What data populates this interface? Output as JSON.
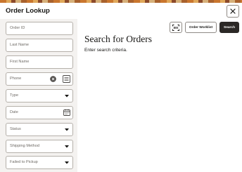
{
  "dialog": {
    "title": "Order Lookup",
    "close_icon": "close-icon"
  },
  "filters": {
    "order_id": {
      "placeholder": "Order ID"
    },
    "last_name": {
      "placeholder": "Last Name"
    },
    "first_name": {
      "placeholder": "First Name"
    },
    "phone": {
      "placeholder": "Phone",
      "clear_icon": "clear-circle-icon",
      "keypad_icon": "keypad-icon"
    },
    "type": {
      "placeholder": "Type",
      "icon": "chevron-down-icon"
    },
    "date": {
      "placeholder": "Date",
      "icon": "calendar-icon"
    },
    "status": {
      "placeholder": "Status",
      "icon": "chevron-down-icon"
    },
    "shipping_method": {
      "placeholder": "Shipping Method",
      "icon": "chevron-down-icon"
    },
    "failed_to_pickup": {
      "placeholder": "Failed to Pickup",
      "icon": "chevron-down-icon"
    }
  },
  "toolbar": {
    "scan_icon": "scan-icon",
    "worklist_label": "Order Worklist",
    "search_label": "Search"
  },
  "main": {
    "heading": "Search for Orders",
    "subtext": "Enter search criteria."
  },
  "colors": {
    "primary_button": "#2b2826",
    "sidebar_bg": "#f4f2f0",
    "border": "#b5b0aa"
  }
}
